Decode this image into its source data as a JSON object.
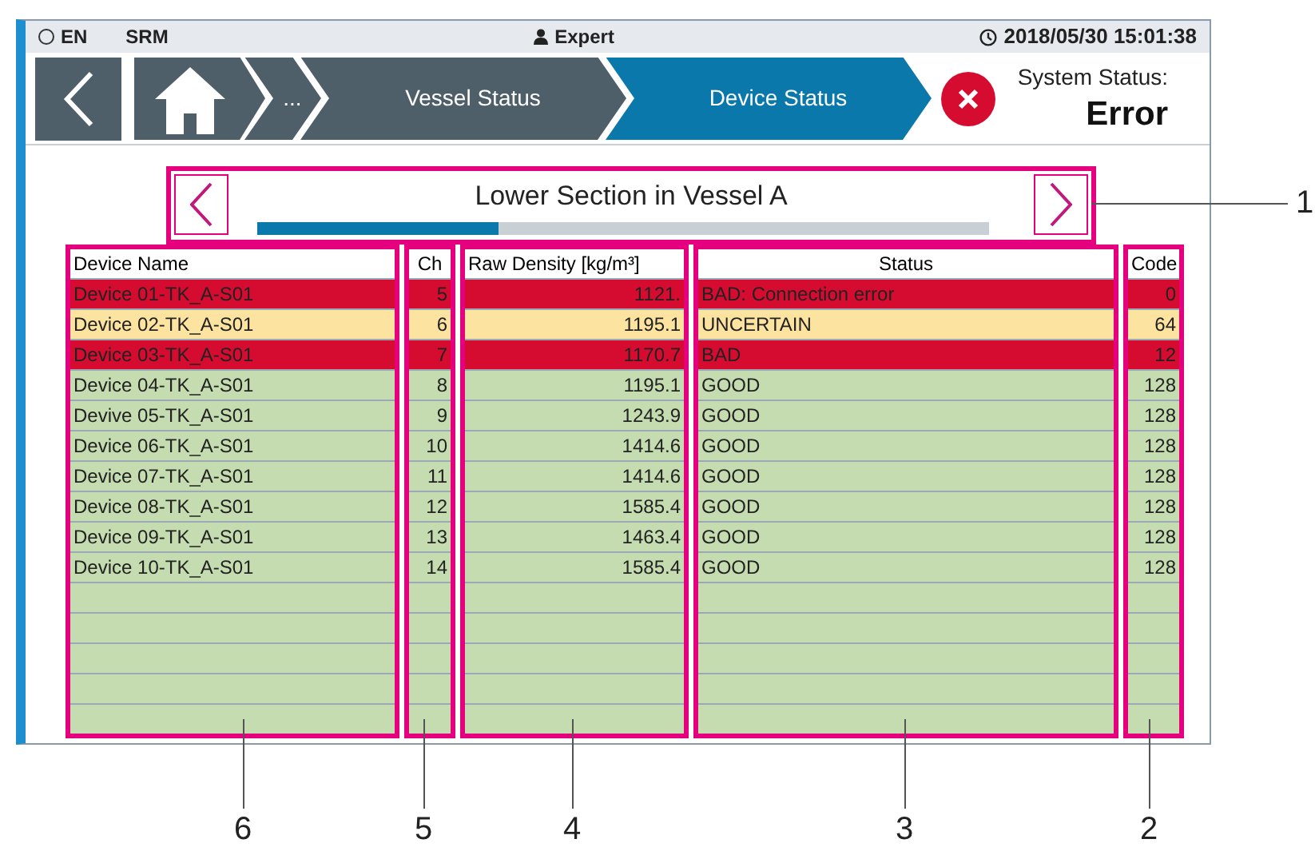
{
  "status_bar": {
    "language": "EN",
    "app": "SRM",
    "user": "Expert",
    "datetime": "2018/05/30 15:01:38"
  },
  "breadcrumbs": [
    {
      "label": "...",
      "selected": false
    },
    {
      "label": "Vessel Status",
      "selected": false
    },
    {
      "label": "Device Status",
      "selected": true
    }
  ],
  "system_status": {
    "label": "System Status:",
    "value": "Error",
    "kind": "error"
  },
  "navigator": {
    "title": "Lower Section in Vessel A",
    "level": 0.33
  },
  "table": {
    "columns": [
      "Device Name",
      "Ch",
      "Raw Density [kg/m³]",
      "Status",
      "Code"
    ],
    "rows": [
      {
        "kind": "bad",
        "cells": [
          "Device 01-TK_A-S01",
          "5",
          "1121.",
          "BAD: Connection error",
          "0"
        ]
      },
      {
        "kind": "uncertain",
        "cells": [
          "Device 02-TK_A-S01",
          "6",
          "1195.1",
          "UNCERTAIN",
          "64"
        ]
      },
      {
        "kind": "bad",
        "cells": [
          "Device 03-TK_A-S01",
          "7",
          "1170.7",
          "BAD",
          "12"
        ]
      },
      {
        "kind": "good",
        "cells": [
          "Device 04-TK_A-S01",
          "8",
          "1195.1",
          "GOOD",
          "128"
        ]
      },
      {
        "kind": "good",
        "cells": [
          "Devive 05-TK_A-S01",
          "9",
          "1243.9",
          "GOOD",
          "128"
        ]
      },
      {
        "kind": "good",
        "cells": [
          "Device 06-TK_A-S01",
          "10",
          "1414.6",
          "GOOD",
          "128"
        ]
      },
      {
        "kind": "good",
        "cells": [
          "Device 07-TK_A-S01",
          "11",
          "1414.6",
          "GOOD",
          "128"
        ]
      },
      {
        "kind": "good",
        "cells": [
          "Device 08-TK_A-S01",
          "12",
          "1585.4",
          "GOOD",
          "128"
        ]
      },
      {
        "kind": "good",
        "cells": [
          "Device 09-TK_A-S01",
          "13",
          "1463.4",
          "GOOD",
          "128"
        ]
      },
      {
        "kind": "good",
        "cells": [
          "Device 10-TK_A-S01",
          "14",
          "1585.4",
          "GOOD",
          "128"
        ]
      }
    ]
  },
  "callouts": [
    "1",
    "6",
    "5",
    "4",
    "3",
    "2"
  ]
}
